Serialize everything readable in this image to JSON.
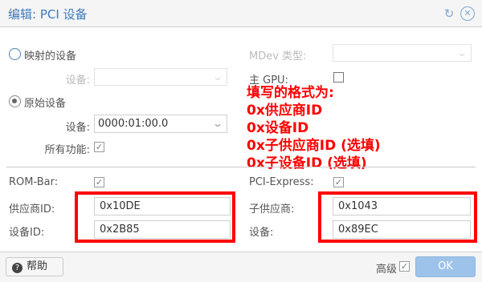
{
  "dialog": {
    "title": "编辑: PCI 设备",
    "reset_icon": "↻",
    "close_icon": "✕"
  },
  "form": {
    "mapped_device": {
      "label": "映射的设备",
      "checked": false
    },
    "mapped_device_select": {
      "label": "设备:",
      "value": ""
    },
    "mdev_type": {
      "label": "MDev 类型:",
      "value": ""
    },
    "primary_gpu": {
      "label": "主 GPU:",
      "checked": false
    },
    "raw_device": {
      "label": "原始设备",
      "checked": true
    },
    "raw_device_select": {
      "label": "设备:",
      "value": "0000:01:00.0"
    },
    "all_functions": {
      "label": "所有功能:",
      "checked": true
    },
    "rom_bar": {
      "label": "ROM-Bar:",
      "checked": true
    },
    "pci_express": {
      "label": "PCI-Express:",
      "checked": true
    },
    "vendor_id": {
      "label": "供应商ID:",
      "value": "0x10DE"
    },
    "device_id": {
      "label": "设备ID:",
      "value": "0x2B85"
    },
    "sub_vendor": {
      "label": "子供应商:",
      "value": "0x1043"
    },
    "sub_device": {
      "label": "设备:",
      "value": "0x89EC"
    }
  },
  "annotation": {
    "lines": [
      "填写的格式为:",
      "0x供应商ID",
      "0x设备ID",
      "0x子供应商ID (选填)",
      "0x子设备ID (选填)"
    ],
    "color": "#ff0000"
  },
  "footer": {
    "help_label": "帮助",
    "advanced_label": "高级",
    "advanced_checked": true,
    "ok_label": "OK"
  },
  "colors": {
    "accent": "#3e7bbd",
    "ok_button": "#9ec3ea",
    "highlight": "#ff0000"
  }
}
